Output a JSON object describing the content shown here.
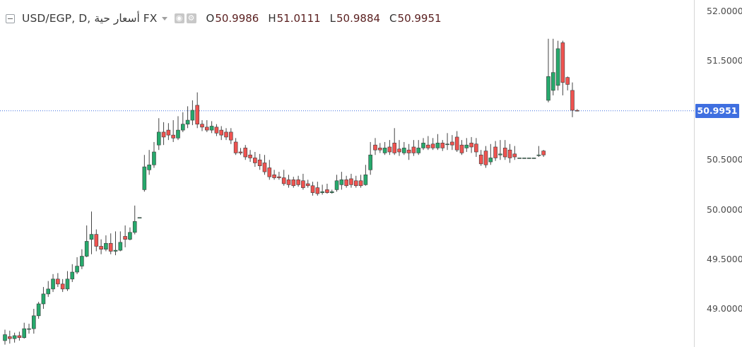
{
  "legend": {
    "symbol": "USD/EGP, D, أسعار حية FX",
    "open_label": "O",
    "open": "50.9986",
    "high_label": "H",
    "high": "51.0111",
    "low_label": "L",
    "low": "50.9884",
    "close_label": "C",
    "close": "50.9951"
  },
  "icons": [
    "collapse-icon",
    "dropdown-icon",
    "eye-icon",
    "gear-icon"
  ],
  "colors": {
    "up": "#26a96c",
    "down": "#ef5350",
    "wick": "#444444",
    "price_line": "#3f6fe0"
  },
  "chart_data": {
    "type": "candlestick",
    "ylim": [
      48.75,
      52.1
    ],
    "y_ticks": [
      "52.0000",
      "51.5000",
      "50.5000",
      "50.0000",
      "49.5000",
      "49.0000"
    ],
    "last_price": "50.9951",
    "last_price_value": 50.9951,
    "candles": [
      [
        48.68,
        48.74,
        48.64,
        48.79
      ],
      [
        48.72,
        48.7,
        48.65,
        48.78
      ],
      [
        48.7,
        48.73,
        48.66,
        48.76
      ],
      [
        48.73,
        48.71,
        48.68,
        48.77
      ],
      [
        48.71,
        48.8,
        48.7,
        48.86
      ],
      [
        48.8,
        48.8,
        48.75,
        48.85
      ],
      [
        48.8,
        48.93,
        48.75,
        49.0
      ],
      [
        48.93,
        49.05,
        48.9,
        49.07
      ],
      [
        49.05,
        49.15,
        49.0,
        49.22
      ],
      [
        49.15,
        49.2,
        49.12,
        49.28
      ],
      [
        49.2,
        49.3,
        49.17,
        49.35
      ],
      [
        49.3,
        49.25,
        49.22,
        49.36
      ],
      [
        49.25,
        49.2,
        49.17,
        49.3
      ],
      [
        49.2,
        49.3,
        49.18,
        49.38
      ],
      [
        49.3,
        49.37,
        49.27,
        49.45
      ],
      [
        49.37,
        49.43,
        49.35,
        49.52
      ],
      [
        49.43,
        49.53,
        49.4,
        49.6
      ],
      [
        49.53,
        49.68,
        49.52,
        49.84
      ],
      [
        49.7,
        49.75,
        49.55,
        49.98
      ],
      [
        49.75,
        49.63,
        49.58,
        49.8
      ],
      [
        49.63,
        49.6,
        49.55,
        49.7
      ],
      [
        49.6,
        49.66,
        49.58,
        49.74
      ],
      [
        49.66,
        49.58,
        49.55,
        49.76
      ],
      [
        49.58,
        49.59,
        49.54,
        49.78
      ],
      [
        49.59,
        49.67,
        49.58,
        49.78
      ],
      [
        49.73,
        49.7,
        49.62,
        49.84
      ],
      [
        49.7,
        49.77,
        49.69,
        49.82
      ],
      [
        49.77,
        49.88,
        49.75,
        50.04
      ],
      [
        49.92,
        49.92,
        49.92,
        49.92
      ],
      [
        50.2,
        50.43,
        50.18,
        50.55
      ],
      [
        50.4,
        50.45,
        50.35,
        50.6
      ],
      [
        50.45,
        50.58,
        50.42,
        50.68
      ],
      [
        50.65,
        50.78,
        50.6,
        50.92
      ],
      [
        50.78,
        50.73,
        50.65,
        50.88
      ],
      [
        50.8,
        50.75,
        50.7,
        50.87
      ],
      [
        50.75,
        50.72,
        50.68,
        50.9
      ],
      [
        50.72,
        50.8,
        50.7,
        50.94
      ],
      [
        50.8,
        50.86,
        50.78,
        50.98
      ],
      [
        50.86,
        50.9,
        50.82,
        51.04
      ],
      [
        50.9,
        51.0,
        50.85,
        51.1
      ],
      [
        51.05,
        50.86,
        50.82,
        51.18
      ],
      [
        50.86,
        50.83,
        50.79,
        50.9
      ],
      [
        50.83,
        50.8,
        50.78,
        50.9
      ],
      [
        50.8,
        50.84,
        50.77,
        50.89
      ],
      [
        50.83,
        50.77,
        50.74,
        50.86
      ],
      [
        50.8,
        50.75,
        50.7,
        50.84
      ],
      [
        50.78,
        50.73,
        50.7,
        50.82
      ],
      [
        50.78,
        50.7,
        50.66,
        50.82
      ],
      [
        50.68,
        50.57,
        50.55,
        50.72
      ],
      [
        50.58,
        50.57,
        50.55,
        50.62
      ],
      [
        50.62,
        50.53,
        50.5,
        50.65
      ],
      [
        50.55,
        50.52,
        50.48,
        50.6
      ],
      [
        50.52,
        50.47,
        50.43,
        50.58
      ],
      [
        50.5,
        50.44,
        50.4,
        50.56
      ],
      [
        50.47,
        50.38,
        50.35,
        50.55
      ],
      [
        50.42,
        50.33,
        50.3,
        50.5
      ],
      [
        50.35,
        50.32,
        50.3,
        50.4
      ],
      [
        50.33,
        50.32,
        50.3,
        50.38
      ],
      [
        50.32,
        50.26,
        50.24,
        50.4
      ],
      [
        50.3,
        50.25,
        50.22,
        50.35
      ],
      [
        50.3,
        50.24,
        50.22,
        50.33
      ],
      [
        50.3,
        50.25,
        50.23,
        50.34
      ],
      [
        50.29,
        50.22,
        50.2,
        50.36
      ],
      [
        50.26,
        50.24,
        50.22,
        50.3
      ],
      [
        50.24,
        50.17,
        50.14,
        50.28
      ],
      [
        50.22,
        50.16,
        50.14,
        50.28
      ],
      [
        50.17,
        50.18,
        50.15,
        50.25
      ],
      [
        50.2,
        50.17,
        50.16,
        50.26
      ],
      [
        50.17,
        50.18,
        50.16,
        50.2
      ],
      [
        50.2,
        50.29,
        50.18,
        50.35
      ],
      [
        50.25,
        50.3,
        50.2,
        50.38
      ],
      [
        50.3,
        50.24,
        50.22,
        50.34
      ],
      [
        50.31,
        50.25,
        50.22,
        50.36
      ],
      [
        50.29,
        50.24,
        50.22,
        50.34
      ],
      [
        50.29,
        50.24,
        50.22,
        50.35
      ],
      [
        50.25,
        50.35,
        50.24,
        50.45
      ],
      [
        50.4,
        50.55,
        50.35,
        50.68
      ],
      [
        50.65,
        50.6,
        50.55,
        50.72
      ],
      [
        50.62,
        50.6,
        50.57,
        50.67
      ],
      [
        50.57,
        50.62,
        50.55,
        50.68
      ],
      [
        50.63,
        50.58,
        50.55,
        50.7
      ],
      [
        50.67,
        50.57,
        50.55,
        50.82
      ],
      [
        50.61,
        50.58,
        50.54,
        50.7
      ],
      [
        50.57,
        50.62,
        50.55,
        50.68
      ],
      [
        50.6,
        50.57,
        50.5,
        50.66
      ],
      [
        50.63,
        50.57,
        50.54,
        50.7
      ],
      [
        50.57,
        50.62,
        50.55,
        50.7
      ],
      [
        50.62,
        50.67,
        50.6,
        50.72
      ],
      [
        50.65,
        50.62,
        50.6,
        50.74
      ],
      [
        50.66,
        50.62,
        50.6,
        50.72
      ],
      [
        50.62,
        50.67,
        50.6,
        50.76
      ],
      [
        50.67,
        50.62,
        50.59,
        50.7
      ],
      [
        50.66,
        50.66,
        50.6,
        50.77
      ],
      [
        50.68,
        50.65,
        50.6,
        50.75
      ],
      [
        50.73,
        50.6,
        50.58,
        50.79
      ],
      [
        50.65,
        50.57,
        50.55,
        50.7
      ],
      [
        50.62,
        50.65,
        50.58,
        50.72
      ],
      [
        50.67,
        50.63,
        50.57,
        50.73
      ],
      [
        50.66,
        50.58,
        50.53,
        50.72
      ],
      [
        50.55,
        50.46,
        50.44,
        50.6
      ],
      [
        50.59,
        50.45,
        50.42,
        50.64
      ],
      [
        50.48,
        50.52,
        50.45,
        50.66
      ],
      [
        50.63,
        50.52,
        50.49,
        50.69
      ],
      [
        50.55,
        50.56,
        50.5,
        50.7
      ],
      [
        50.62,
        50.53,
        50.5,
        50.7
      ],
      [
        50.6,
        50.52,
        50.47,
        50.66
      ],
      [
        50.56,
        50.53,
        50.5,
        50.64
      ],
      [
        50.52,
        50.52,
        50.52,
        50.52
      ],
      [
        50.52,
        50.52,
        50.52,
        50.52
      ],
      [
        50.52,
        50.52,
        50.52,
        50.52
      ],
      [
        50.52,
        50.52,
        50.52,
        50.52
      ],
      [
        50.55,
        50.55,
        50.53,
        50.64
      ],
      [
        50.59,
        50.55,
        50.53,
        50.6
      ],
      [
        51.1,
        51.34,
        51.08,
        51.72
      ],
      [
        51.2,
        51.38,
        51.15,
        51.72
      ],
      [
        51.25,
        51.62,
        51.2,
        51.7
      ],
      [
        51.68,
        51.28,
        51.15,
        51.7
      ],
      [
        51.33,
        51.26,
        51.2,
        51.34
      ],
      [
        51.2,
        51.0,
        50.93,
        51.28
      ],
      [
        50.9986,
        50.9951,
        50.9884,
        51.0111
      ]
    ]
  }
}
